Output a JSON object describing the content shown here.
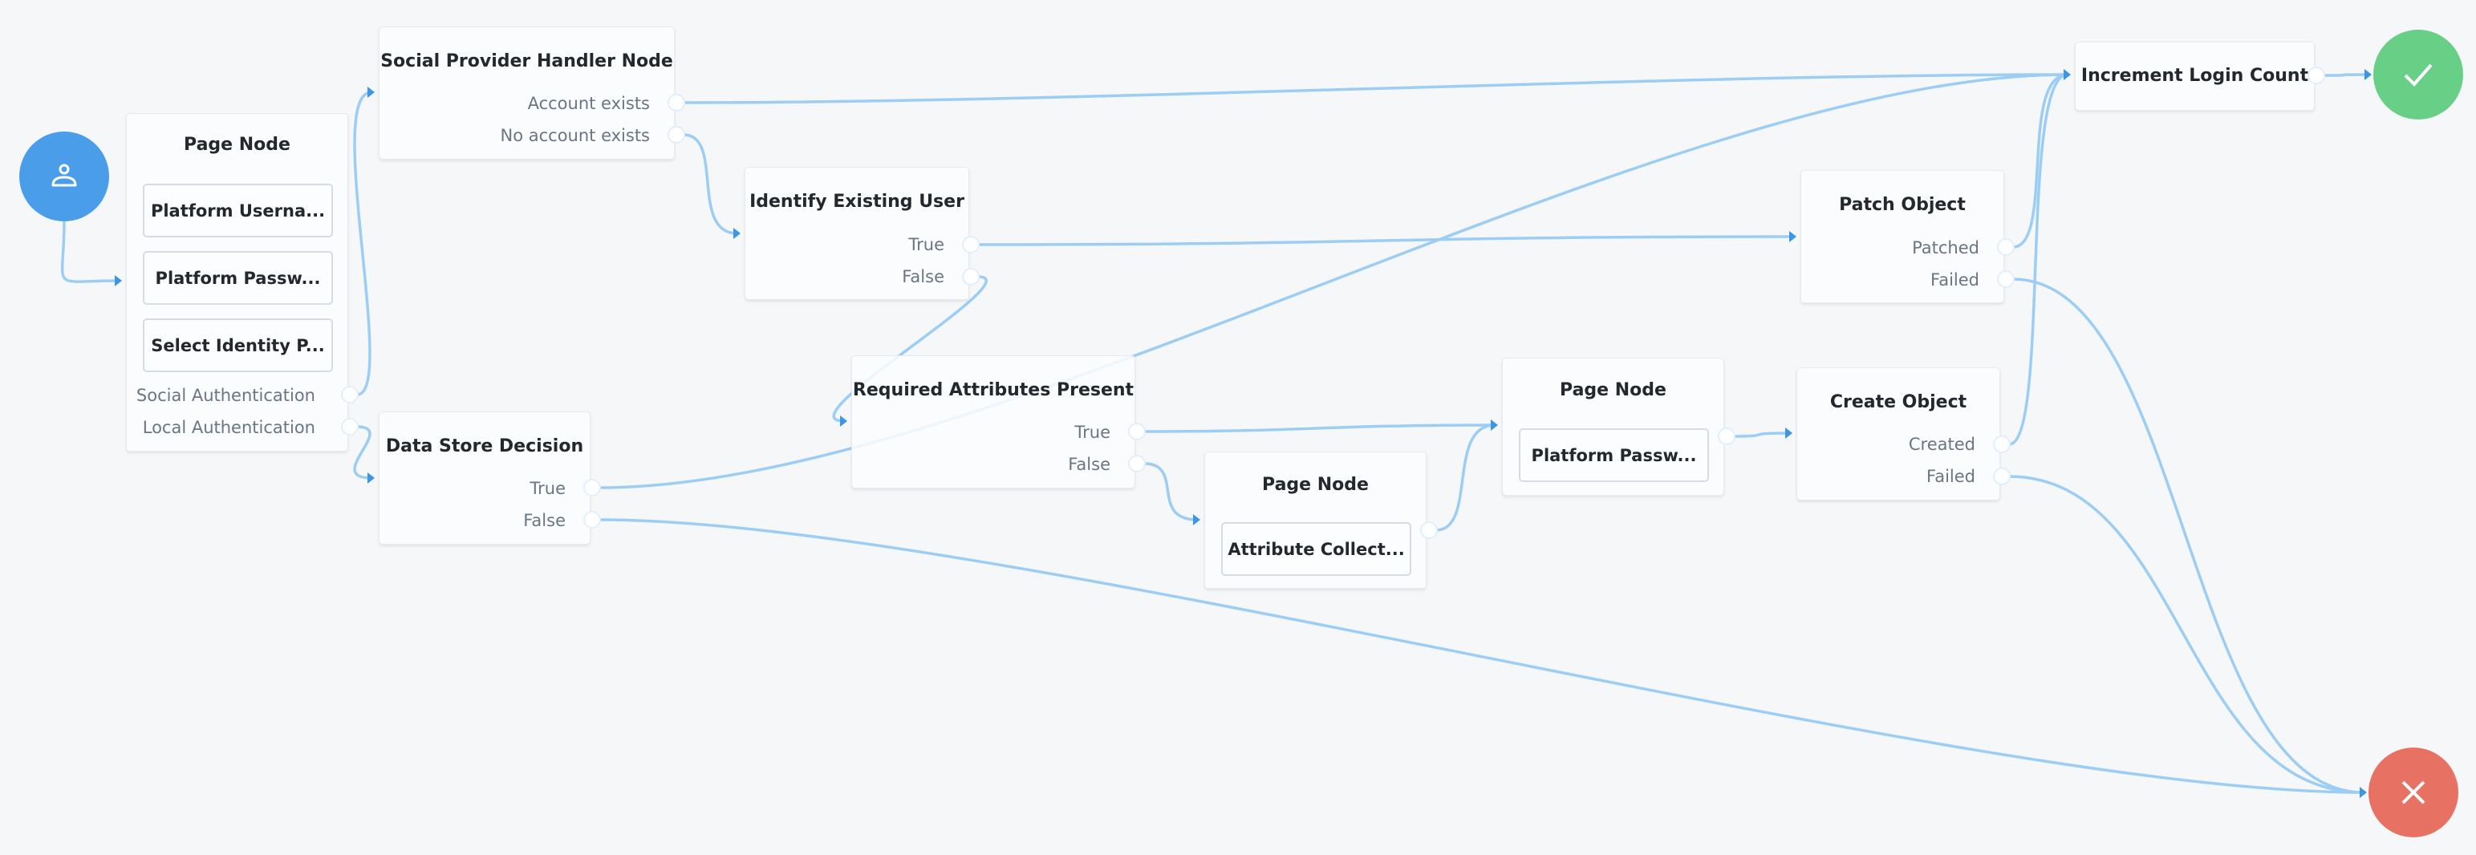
{
  "colors": {
    "background": "#f6f7f9",
    "link": "#9ccdf5",
    "arrow": "#3c95e6",
    "start": "#4a9ee9",
    "success": "#68cf86",
    "failure": "#e77264"
  },
  "start": {
    "icon": "user-icon",
    "label": "Start"
  },
  "success": {
    "icon": "checkmark-icon",
    "label": "Success"
  },
  "failure": {
    "icon": "x-icon",
    "label": "Failure"
  },
  "nodes": [
    {
      "id": "page1",
      "title": "Page Node",
      "children": [
        "Platform Userna...",
        "Platform Passw...",
        "Select Identity P..."
      ],
      "outcomes": [
        "Social Authentication",
        "Local Authentication"
      ]
    },
    {
      "id": "social",
      "title": "Social Provider Handler Node",
      "outcomes": [
        "Account exists",
        "No account exists"
      ]
    },
    {
      "id": "datastore",
      "title": "Data Store Decision",
      "outcomes": [
        "True",
        "False"
      ]
    },
    {
      "id": "identify",
      "title": "Identify Existing User",
      "outcomes": [
        "True",
        "False"
      ]
    },
    {
      "id": "required",
      "title": "Required Attributes Present",
      "outcomes": [
        "True",
        "False"
      ]
    },
    {
      "id": "page3",
      "title": "Page Node",
      "children": [
        "Attribute Collect..."
      ],
      "outcomes": []
    },
    {
      "id": "page2",
      "title": "Page Node",
      "children": [
        "Platform Passw..."
      ],
      "outcomes": []
    },
    {
      "id": "create",
      "title": "Create Object",
      "outcomes": [
        "Created",
        "Failed"
      ]
    },
    {
      "id": "patch",
      "title": "Patch Object",
      "outcomes": [
        "Patched",
        "Failed"
      ]
    },
    {
      "id": "increment",
      "title": "Increment Login Count",
      "outcomes": []
    }
  ],
  "connections": [
    {
      "from": "start",
      "to": "page1"
    },
    {
      "from": "page1:Social Authentication",
      "to": "social"
    },
    {
      "from": "page1:Local Authentication",
      "to": "datastore"
    },
    {
      "from": "social:Account exists",
      "to": "increment"
    },
    {
      "from": "social:No account exists",
      "to": "identify"
    },
    {
      "from": "datastore:True",
      "to": "increment"
    },
    {
      "from": "datastore:False",
      "to": "failure"
    },
    {
      "from": "identify:True",
      "to": "patch"
    },
    {
      "from": "identify:False",
      "to": "required"
    },
    {
      "from": "required:True",
      "to": "page2"
    },
    {
      "from": "required:False",
      "to": "page3"
    },
    {
      "from": "page3",
      "to": "page2"
    },
    {
      "from": "page2",
      "to": "create"
    },
    {
      "from": "create:Created",
      "to": "increment"
    },
    {
      "from": "create:Failed",
      "to": "failure"
    },
    {
      "from": "patch:Patched",
      "to": "increment"
    },
    {
      "from": "patch:Failed",
      "to": "failure"
    },
    {
      "from": "increment",
      "to": "success"
    }
  ]
}
